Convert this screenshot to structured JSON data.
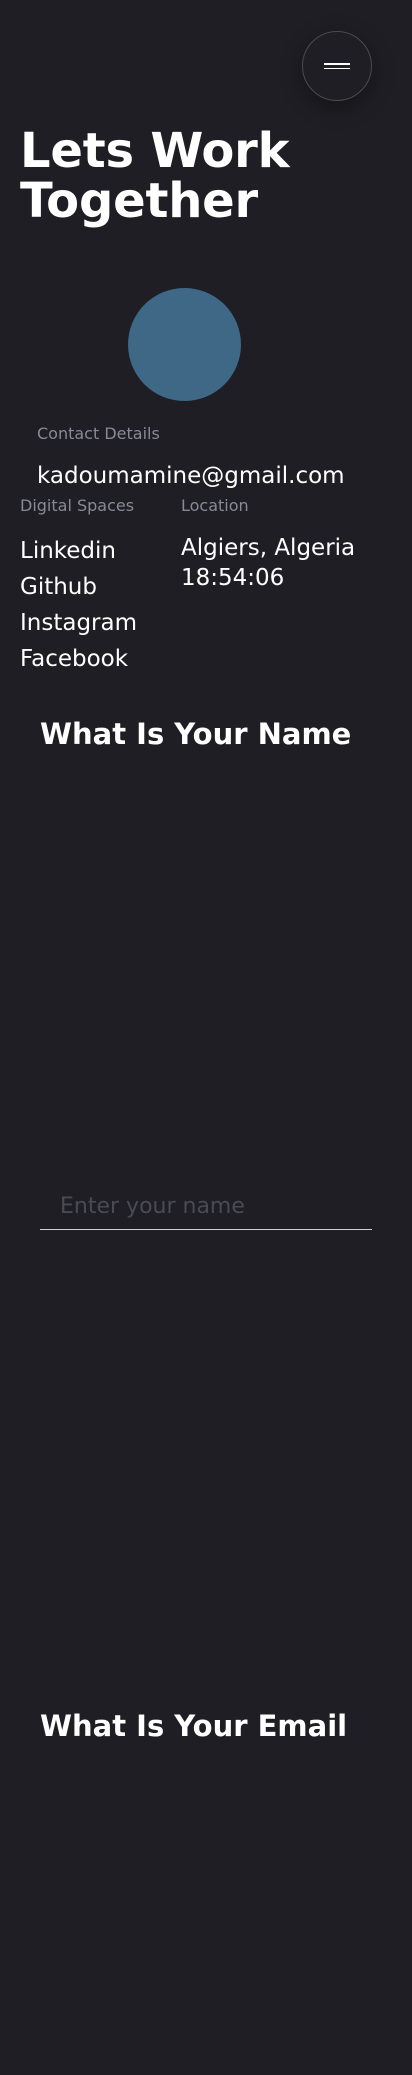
{
  "menu": {
    "icon": "hamburger-icon"
  },
  "hero": {
    "title": "Lets Work Together"
  },
  "avatar": {
    "color": "#3e6886"
  },
  "contact": {
    "label": "Contact Details",
    "email": "kadoumamine@gmail.com"
  },
  "digital": {
    "label": "Digital Spaces",
    "items": [
      "Linkedin",
      "Github",
      "Instagram",
      "Facebook"
    ]
  },
  "location": {
    "label": "Location",
    "city": "Algiers, Algeria",
    "time": "18:54:06"
  },
  "form": {
    "name_question": "What Is Your Name",
    "name_placeholder": "Enter your name",
    "email_question": "What Is Your Email"
  },
  "colors": {
    "background": "#1e1e24",
    "muted_text": "#8a8a96",
    "accent": "#3e6886"
  }
}
